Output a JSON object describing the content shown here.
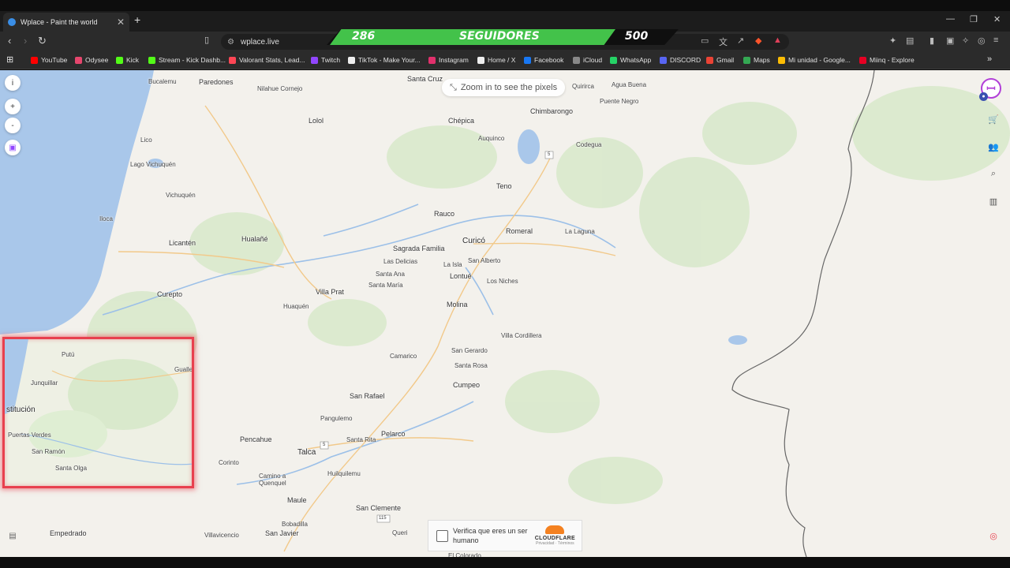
{
  "browser": {
    "tab_title": "Wplace - Paint the world",
    "tab_close": "✕",
    "new_tab": "+",
    "url": "wplace.live",
    "window_controls": [
      "—",
      "❐",
      "✕"
    ]
  },
  "stream_overlay": {
    "count": "286",
    "label": "SEGUIDORES",
    "goal": "500",
    "progress": 0.572
  },
  "bookmarks": [
    {
      "label": "YouTube",
      "color": "#ff0000"
    },
    {
      "label": "Odysee",
      "color": "#e5466d"
    },
    {
      "label": "Kick",
      "color": "#53fc18"
    },
    {
      "label": "Stream - Kick Dashb...",
      "color": "#53fc18"
    },
    {
      "label": "Valorant Stats, Lead...",
      "color": "#ff4655"
    },
    {
      "label": "Twitch",
      "color": "#9146ff"
    },
    {
      "label": "TikTok - Make Your...",
      "color": "#eeeeee"
    },
    {
      "label": "Instagram",
      "color": "#e1306c"
    },
    {
      "label": "Home / X",
      "color": "#eeeeee"
    },
    {
      "label": "Facebook",
      "color": "#1877f2"
    },
    {
      "label": "iCloud",
      "color": "#888888"
    },
    {
      "label": "WhatsApp",
      "color": "#25d366"
    },
    {
      "label": "DISCORD",
      "color": "#5865f2"
    },
    {
      "label": "Gmail",
      "color": "#ea4335"
    },
    {
      "label": "Maps",
      "color": "#34a853"
    },
    {
      "label": "Mi unidad - Google...",
      "color": "#fbbc04"
    },
    {
      "label": "Miinq - Explore",
      "color": "#e60023"
    }
  ],
  "map": {
    "zoom_hint": "Zoom in to see the pixels",
    "left_buttons": [
      "i",
      "+",
      "-",
      "▣"
    ],
    "cities": [
      {
        "name": "Bucalemu",
        "cls": ""
      },
      {
        "name": "Paredones",
        "cls": "big"
      },
      {
        "name": "Nilahue Cornejo",
        "cls": ""
      },
      {
        "name": "Santa Cruz",
        "cls": "big"
      },
      {
        "name": "Quirirca",
        "cls": ""
      },
      {
        "name": "Agua Buena",
        "cls": ""
      },
      {
        "name": "Puente Negro",
        "cls": ""
      },
      {
        "name": "Lolol",
        "cls": "big"
      },
      {
        "name": "Chépica",
        "cls": "big"
      },
      {
        "name": "Chimbarongo",
        "cls": "big"
      },
      {
        "name": "Auquinco",
        "cls": ""
      },
      {
        "name": "Codegua",
        "cls": ""
      },
      {
        "name": "Lico",
        "cls": ""
      },
      {
        "name": "Lago Vichuquén",
        "cls": ""
      },
      {
        "name": "Vichuquén",
        "cls": ""
      },
      {
        "name": "Teno",
        "cls": "big"
      },
      {
        "name": "Iloca",
        "cls": ""
      },
      {
        "name": "Rauco",
        "cls": "big"
      },
      {
        "name": "Romeral",
        "cls": "big"
      },
      {
        "name": "La Laguna",
        "cls": ""
      },
      {
        "name": "Licantén",
        "cls": "big"
      },
      {
        "name": "Hualañé",
        "cls": "big"
      },
      {
        "name": "Sagrada Familia",
        "cls": "big"
      },
      {
        "name": "Curicó",
        "cls": "bigger"
      },
      {
        "name": "Las Delicias",
        "cls": ""
      },
      {
        "name": "San Alberto",
        "cls": ""
      },
      {
        "name": "La Isla",
        "cls": ""
      },
      {
        "name": "Santa Ana",
        "cls": ""
      },
      {
        "name": "Lontué",
        "cls": "big"
      },
      {
        "name": "Los Niches",
        "cls": ""
      },
      {
        "name": "Santa María",
        "cls": ""
      },
      {
        "name": "Curepto",
        "cls": "big"
      },
      {
        "name": "Villa Prat",
        "cls": "big"
      },
      {
        "name": "Huaquén",
        "cls": ""
      },
      {
        "name": "Molina",
        "cls": "big"
      },
      {
        "name": "Villa Cordillera",
        "cls": ""
      },
      {
        "name": "San Gerardo",
        "cls": ""
      },
      {
        "name": "Camarico",
        "cls": ""
      },
      {
        "name": "Santa Rosa",
        "cls": ""
      },
      {
        "name": "Cumpeo",
        "cls": "big"
      },
      {
        "name": "San Rafael",
        "cls": "big"
      },
      {
        "name": "Pangulemo",
        "cls": ""
      },
      {
        "name": "Pelarco",
        "cls": "big"
      },
      {
        "name": "Pencahue",
        "cls": "big"
      },
      {
        "name": "Santa Rita",
        "cls": ""
      },
      {
        "name": "Talca",
        "cls": "bigger"
      },
      {
        "name": "Corinto",
        "cls": ""
      },
      {
        "name": "Huilquilemu",
        "cls": ""
      },
      {
        "name": "Camino a",
        "cls": ""
      },
      {
        "name": "Quenquel",
        "cls": ""
      },
      {
        "name": "Maule",
        "cls": "big"
      },
      {
        "name": "San Clemente",
        "cls": "big"
      },
      {
        "name": "Bobadilla",
        "cls": ""
      },
      {
        "name": "Empedrado",
        "cls": "big"
      },
      {
        "name": "Villavicencio",
        "cls": ""
      },
      {
        "name": "San Javier",
        "cls": "big"
      },
      {
        "name": "Queri",
        "cls": ""
      },
      {
        "name": "El Colorado",
        "cls": ""
      }
    ],
    "road_shields": [
      "5",
      "5",
      "115"
    ]
  },
  "webcam": {
    "places": [
      "Putú",
      "Gualleco",
      "Junquillar",
      "stitución",
      "Puertas Verdes",
      "San Ramón",
      "Santa Olga"
    ]
  },
  "captcha": {
    "text": "Verifica que eres un ser humano",
    "brand": "CLOUDFLARE",
    "legal": "Privacidad · Términos"
  }
}
